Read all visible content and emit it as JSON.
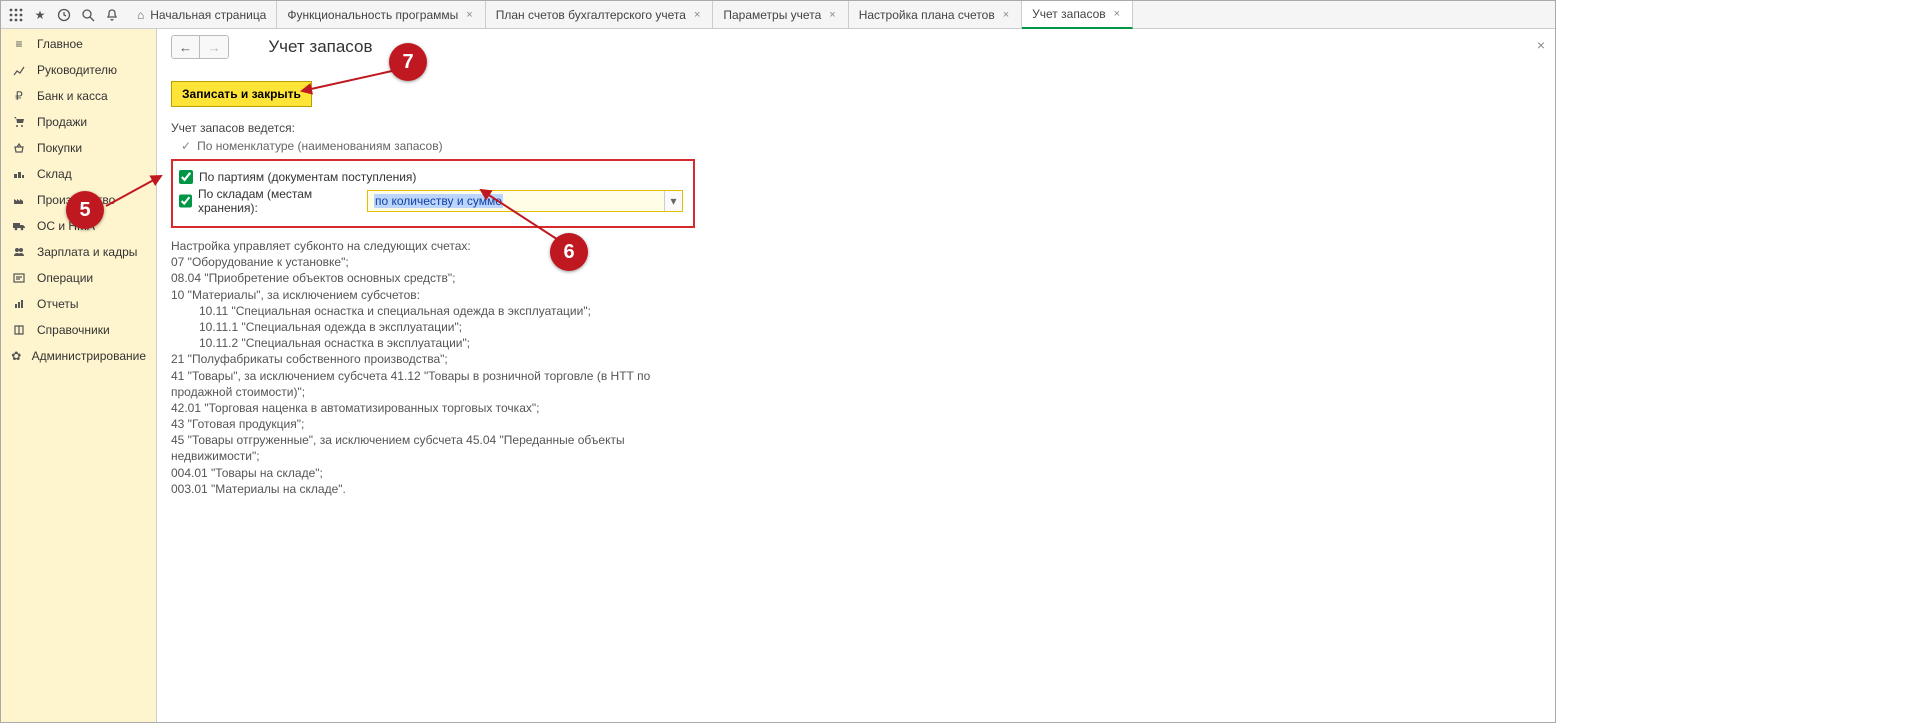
{
  "toolbar_icons": [
    "apps",
    "star",
    "history",
    "search",
    "bell"
  ],
  "tabs": [
    {
      "label": "Начальная страница",
      "home": true,
      "closable": false
    },
    {
      "label": "Функциональность программы",
      "closable": true
    },
    {
      "label": "План счетов бухгалтерского учета",
      "closable": true
    },
    {
      "label": "Параметры учета",
      "closable": true
    },
    {
      "label": "Настройка плана счетов",
      "closable": true
    },
    {
      "label": "Учет запасов",
      "closable": true,
      "active": true
    }
  ],
  "sidebar": [
    {
      "icon": "menu",
      "label": "Главное"
    },
    {
      "icon": "chart",
      "label": "Руководителю"
    },
    {
      "icon": "ruble",
      "label": "Банк и касса"
    },
    {
      "icon": "cart",
      "label": "Продажи"
    },
    {
      "icon": "basket",
      "label": "Покупки"
    },
    {
      "icon": "warehouse",
      "label": "Склад"
    },
    {
      "icon": "factory",
      "label": "Производство"
    },
    {
      "icon": "truck",
      "label": "ОС и НМА"
    },
    {
      "icon": "people",
      "label": "Зарплата и кадры"
    },
    {
      "icon": "ops",
      "label": "Операции"
    },
    {
      "icon": "reports",
      "label": "Отчеты"
    },
    {
      "icon": "book",
      "label": "Справочники"
    },
    {
      "icon": "gear",
      "label": "Администрирование"
    }
  ],
  "page": {
    "title": "Учет запасов",
    "save_btn": "Записать и закрыть",
    "section_label": "Учет запасов ведется:",
    "locked_check": "По номенклатуре (наименованиям запасов)",
    "chk1": "По партиям (документам поступления)",
    "chk2": "По складам (местам хранения):",
    "dd_value": "по количеству и сумме",
    "desc_lines": [
      "Настройка управляет субконто на следующих счетах:",
      "07 \"Оборудование к установке\";",
      "08.04 \"Приобретение объектов основных средств\";",
      "10 \"Материалы\", за исключением субсчетов:",
      "__10.11 \"Специальная оснастка и специальная одежда в эксплуатации\";",
      "__10.11.1 \"Специальная одежда в эксплуатации\";",
      "__10.11.2 \"Специальная оснастка в эксплуатации\";",
      "21 \"Полуфабрикаты собственного производства\";",
      "41 \"Товары\", за исключением субсчета 41.12 \"Товары в розничной торговле (в НТТ по продажной стоимости)\";",
      "42.01 \"Торговая наценка в автоматизированных торговых точках\";",
      "43 \"Готовая продукция\";",
      "45 \"Товары отгруженные\", за исключением субсчета 45.04 \"Переданные объекты недвижимости\";",
      "004.01 \"Товары на складе\";",
      "003.01 \"Материалы на складе\"."
    ]
  },
  "markers": {
    "m5": "5",
    "m6": "6",
    "m7": "7"
  }
}
